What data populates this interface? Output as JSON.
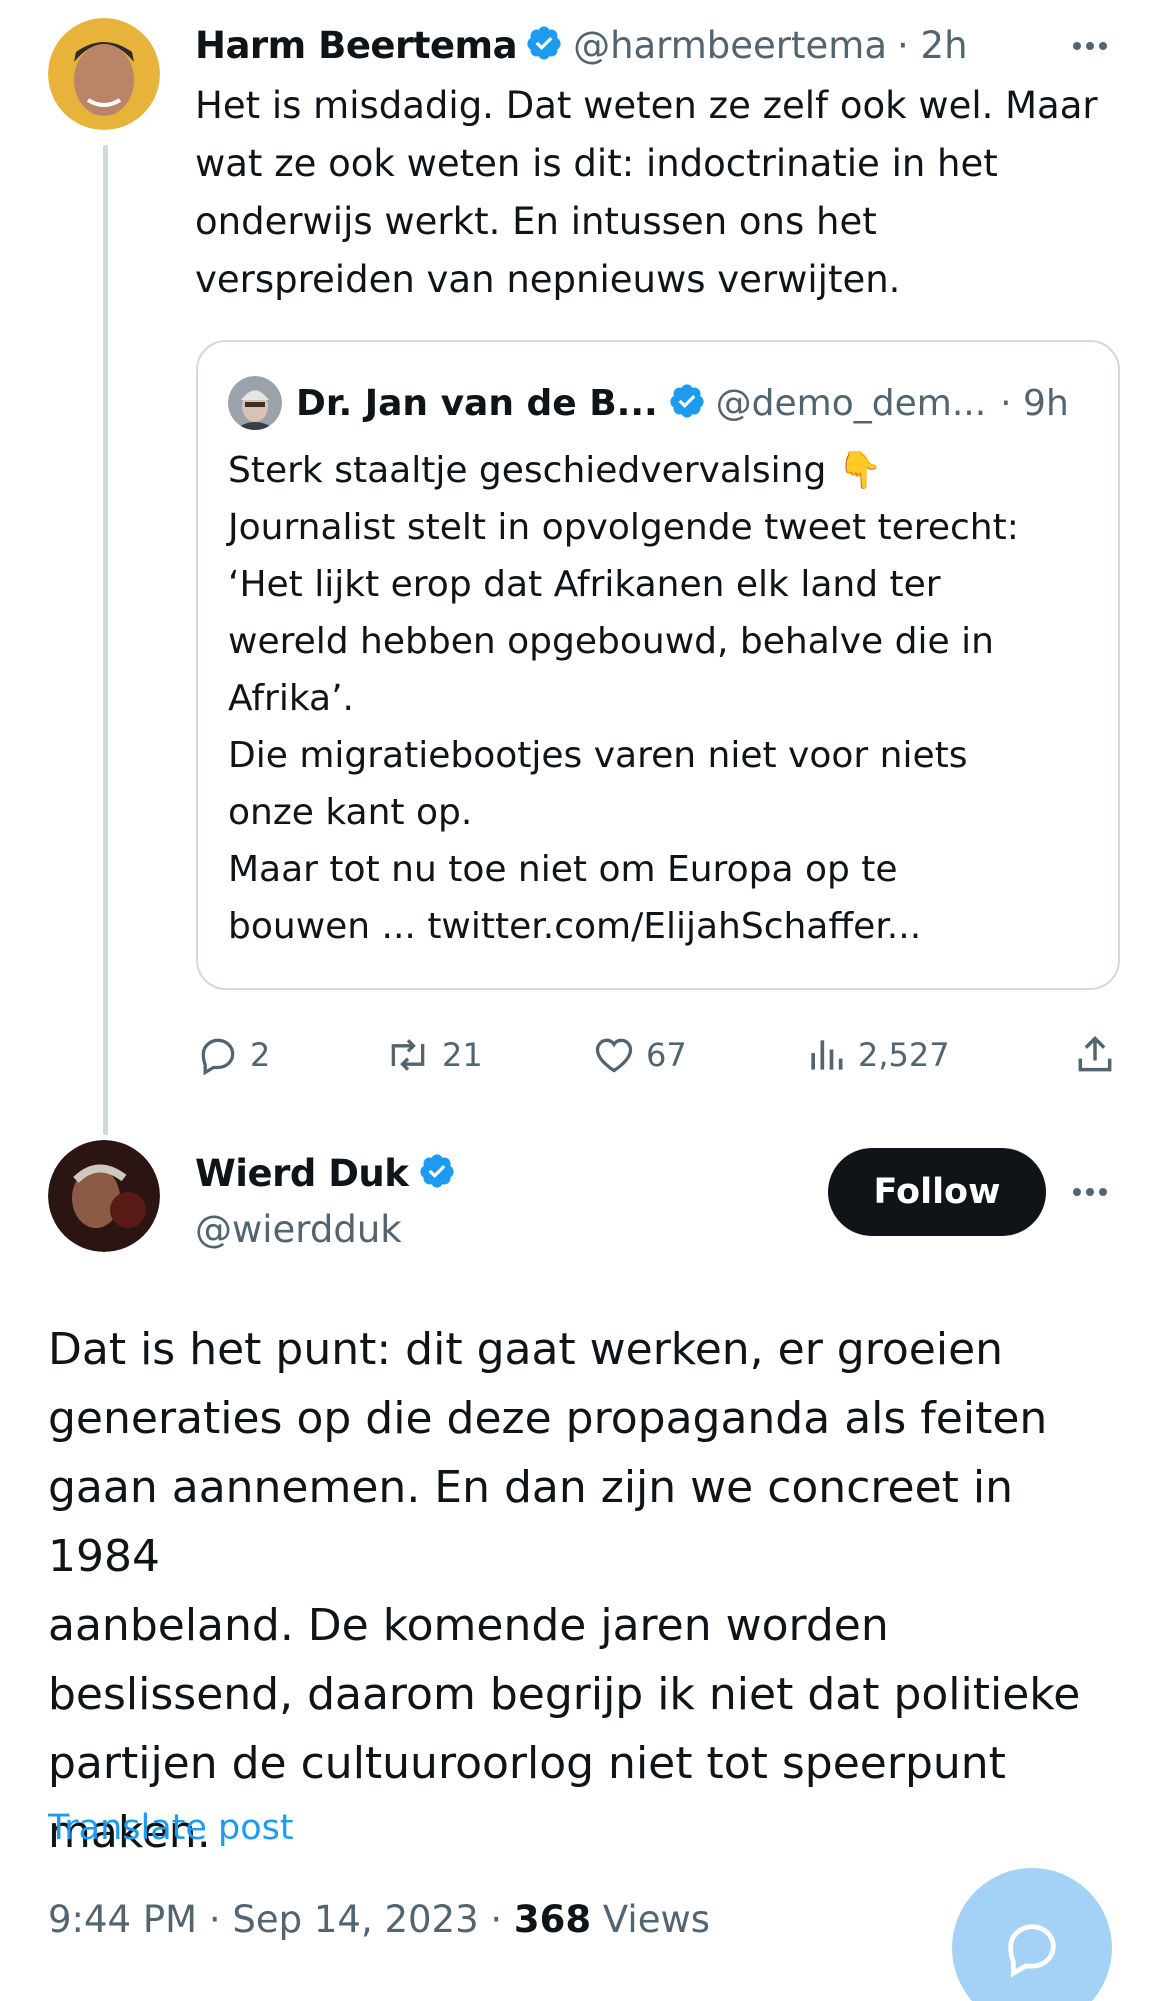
{
  "tweet1": {
    "author_name": "Harm Beertema",
    "handle": "@harmbeertema",
    "time": "· 2h",
    "text": "Het is misdadig. Dat weten ze zelf ook wel. Maar\nwat ze ook weten is dit: indoctrinatie in het\nonderwijs werkt. En intussen ons het\nverspreiden van nepnieuws verwijten.",
    "quote": {
      "author_name": "Dr. Jan van de B...",
      "handle": "@demo_dem...",
      "time": "· 9h",
      "text": "Sterk staaltje geschiedvervalsing 👇\nJournalist stelt in opvolgende tweet terecht:\n‘Het lijkt erop dat Afrikanen elk land ter\nwereld hebben opgebouwd, behalve die in\nAfrika’.\nDie migratiebootjes varen niet voor niets\nonze kant op.\nMaar tot nu toe niet om Europa op te\nbouwen ... twitter.com/ElijahSchaffer..."
    },
    "stats": {
      "replies": "2",
      "reposts": "21",
      "likes": "67",
      "views": "2,527"
    }
  },
  "tweet2": {
    "author_name": "Wierd Duk",
    "handle": "@wierdduk",
    "follow_label": "Follow",
    "text": "Dat is het punt: dit gaat werken, er groeien\ngeneraties op die deze propaganda als feiten\ngaan aannemen. En dan zijn we concreet in 1984\naanbeland. De komende jaren worden\nbeslissend, daarom begrijp ik niet dat politieke\npartijen de cultuuroorlog niet tot speerpunt\nmaken.",
    "translate_label": "Translate post",
    "timestamp": "9:44 PM · Sep 14, 2023 · ",
    "views_count": "368",
    "views_label": " Views"
  },
  "colors": {
    "accent": "#1d9bf0",
    "text": "#0f1419",
    "muted": "#536471",
    "border": "#cfd9de",
    "verified": "#1d9bf0"
  },
  "icons": [
    "verified-badge-icon",
    "more-icon",
    "reply-icon",
    "repost-icon",
    "like-icon",
    "views-icon",
    "share-icon",
    "compose-reply-icon"
  ]
}
